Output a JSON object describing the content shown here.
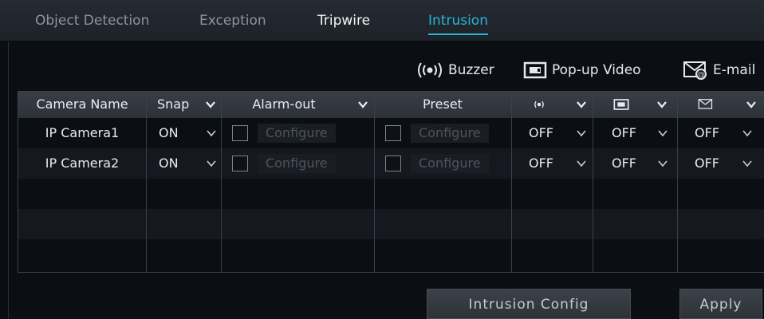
{
  "tabs": [
    {
      "label": "Object Detection"
    },
    {
      "label": "Exception"
    },
    {
      "label": "Tripwire"
    },
    {
      "label": "Intrusion",
      "active": true
    }
  ],
  "legend": {
    "buzzer": "Buzzer",
    "popup": "Pop-up Video",
    "email": "E-mail"
  },
  "table": {
    "headers": {
      "camera_name": "Camera Name",
      "snap": "Snap",
      "alarm_out": "Alarm-out",
      "preset": "Preset"
    },
    "rows": [
      {
        "camera": "IP Camera1",
        "snap": "ON",
        "alarm_out_checked": false,
        "alarm_out_btn": "Configure",
        "preset_checked": false,
        "preset_btn": "Configure",
        "buzzer": "OFF",
        "popup": "OFF",
        "email": "OFF"
      },
      {
        "camera": "IP Camera2",
        "snap": "ON",
        "alarm_out_checked": false,
        "alarm_out_btn": "Configure",
        "preset_checked": false,
        "preset_btn": "Configure",
        "buzzer": "OFF",
        "popup": "OFF",
        "email": "OFF"
      }
    ]
  },
  "buttons": {
    "intrusion_config": "Intrusion Config",
    "apply": "Apply"
  },
  "colors": {
    "accent": "#27b5d8",
    "background": "#0a0d12"
  },
  "icons": {
    "buzzer": "buzzer-icon",
    "popup": "popup-video-icon",
    "email": "email-icon"
  }
}
